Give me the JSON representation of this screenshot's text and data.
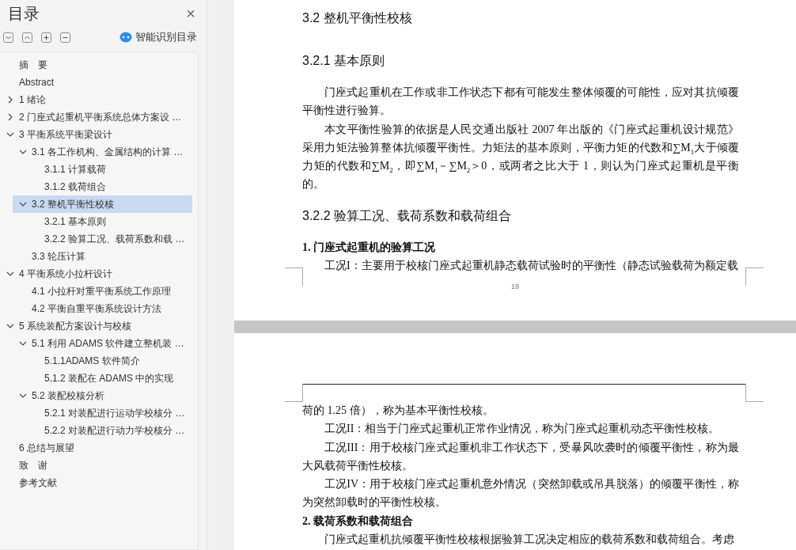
{
  "sidebar": {
    "title": "目录",
    "close": "×",
    "toolbar": [
      {
        "kind": "expand-all"
      },
      {
        "kind": "collapse-all"
      },
      {
        "kind": "plus"
      },
      {
        "kind": "minus"
      }
    ],
    "smart_button": "智能识别目录",
    "outline": [
      {
        "label": "摘　要",
        "selected": false
      },
      {
        "label": "Abstract",
        "selected": false
      },
      {
        "label": "1 绪论",
        "selected": false,
        "expanded": false
      },
      {
        "label": "2 门座式起重机平衡系统总体方案设 …",
        "selected": false,
        "expanded": false
      },
      {
        "label": "3 平衡系统平衡梁设计",
        "selected": false,
        "expanded": true,
        "children": [
          {
            "label": "3.1 各工作机构、金属结构的计算 …",
            "selected": false,
            "expanded": true,
            "children": [
              {
                "label": "3.1.1  计算载荷",
                "selected": false
              },
              {
                "label": "3.1.2  载荷组合",
                "selected": false
              }
            ]
          },
          {
            "label": "3.2  整机平衡性校核",
            "selected": true,
            "expanded": true,
            "children": [
              {
                "label": "3.2.1 基本原则",
                "selected": false
              },
              {
                "label": "3.2.2 验算工况、载荷系数和载 …",
                "selected": false
              }
            ]
          },
          {
            "label": "3.3 轮压计算",
            "selected": false
          }
        ]
      },
      {
        "label": "4 平衡系统小拉杆设计",
        "selected": false,
        "expanded": true,
        "children": [
          {
            "label": "4.1 小拉杆对重平衡系统工作原理",
            "selected": false
          },
          {
            "label": "4.2 平衡自重平衡系统设计方法",
            "selected": false
          }
        ]
      },
      {
        "label": "5 系统装配方案设计与校核",
        "selected": false,
        "expanded": true,
        "children": [
          {
            "label": "5.1 利用 ADAMS 软件建立整机装 …",
            "selected": false,
            "expanded": true,
            "children": [
              {
                "label": "5.1.1ADAMS 软件简介",
                "selected": false
              },
              {
                "label": "5.1.2 装配在 ADAMS 中的实现",
                "selected": false
              }
            ]
          },
          {
            "label": "5.2 装配校核分析",
            "selected": false,
            "expanded": true,
            "children": [
              {
                "label": "5.2.1 对装配进行运动学校核分 …",
                "selected": false
              },
              {
                "label": "5.2.2 对装配进行动力学校核分 …",
                "selected": false
              }
            ]
          }
        ]
      },
      {
        "label": "6 总结与展望",
        "selected": false
      },
      {
        "label": "致　谢",
        "selected": false
      },
      {
        "label": "参考文献",
        "selected": false
      }
    ]
  },
  "pages": [
    {
      "blocks": [
        {
          "kind": "h2",
          "text": "3.2  整机平衡性校核"
        },
        {
          "kind": "h3",
          "text": "3.2.1 基本原则"
        },
        {
          "kind": "para",
          "text": "门座式起重机在工作或非工作状态下都有可能发生整体倾覆的可能性，应对其抗倾覆平衡性进行验算。"
        },
        {
          "kind": "para",
          "text": "本文平衡性验算的依据是人民交通出版社 2007 年出版的《门座式起重机设计规范》采用力矩法验算整体抗倾覆平衡性。力矩法的基本原则，平衡力矩的代数和∑M$_{1}$大于倾覆力矩的代数和∑M$_{2}$，即∑M$_{1}$－∑M$_{2}$＞0，或两者之比大于 1，则认为门座式起重机是平衡的。"
        },
        {
          "kind": "h3",
          "text": "3.2.2 验算工况、载荷系数和载荷组合"
        },
        {
          "kind": "h4",
          "text": "1.  门座式起重机的验算工况"
        },
        {
          "kind": "para",
          "text": "工况I：主要用于校核门座式起重机静态载荷试验时的平衡性（静态试验载荷为额定载"
        }
      ],
      "page_number": "19"
    },
    {
      "blocks": [
        {
          "kind": "cont",
          "text": "荷的 1.25 倍），称为基本平衡性校核。"
        },
        {
          "kind": "para",
          "text": "工况II：相当于门座式起重机正常作业情况，称为门座式起重机动态平衡性校核。"
        },
        {
          "kind": "para",
          "text": "工况III：用于校核门座式起重机非工作状态下，受暴风吹袭时的倾覆平衡性，称为最大风载荷平衡性校核。"
        },
        {
          "kind": "para",
          "text": "工况IV：用于校核门座式起重机意外情况（突然卸载或吊具脱落）的倾覆平衡性，称为突然卸载时的平衡性校核。"
        },
        {
          "kind": "h4",
          "text": "2.  载荷系数和载荷组合"
        },
        {
          "kind": "para",
          "text": "门座式起重机抗倾覆平衡性校核根据验算工况决定相应的载荷系数和载荷组合。考虑"
        }
      ]
    }
  ]
}
